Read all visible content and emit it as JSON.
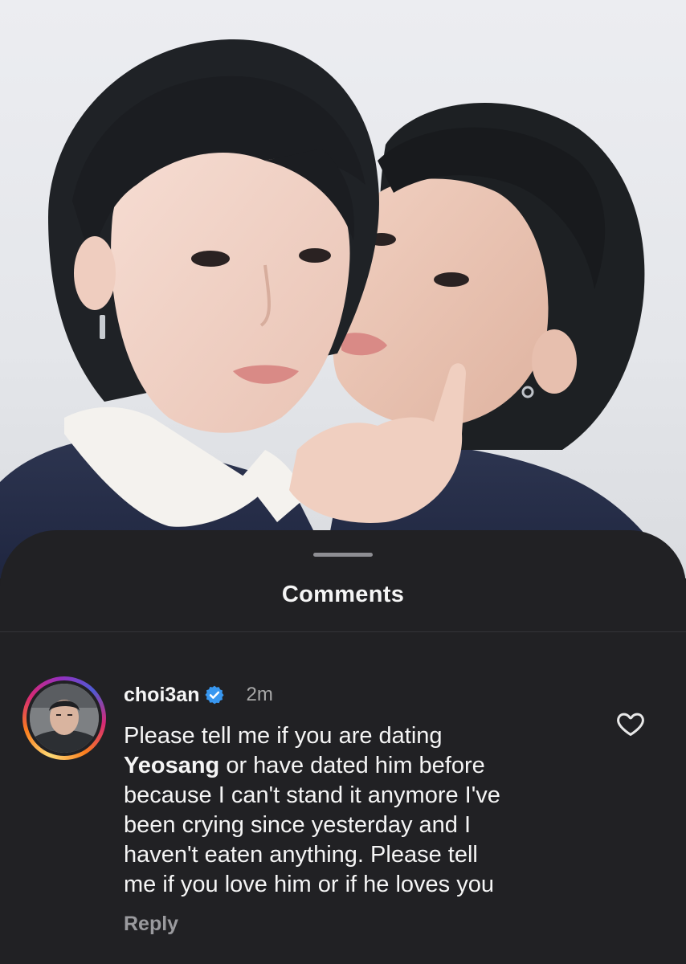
{
  "sheet": {
    "title": "Comments"
  },
  "comment": {
    "username": "choi3an",
    "verified": true,
    "timestamp": "2m",
    "text_line1": "Please tell me if you are dating",
    "mention": "Yeosang",
    "text_rest": " or have dated him before\nbecause I can't stand it anymore I've\nbeen crying since yesterday and I\nhaven't eaten anything. Please tell\nme if you love him or if he loves you",
    "reply_label": "Reply",
    "like_icon": "heart-icon"
  },
  "colors": {
    "sheet_background": "#212124",
    "text_primary": "#f5f5f5",
    "text_secondary": "#a8a8a8",
    "verified_badge": "#3897f0"
  }
}
